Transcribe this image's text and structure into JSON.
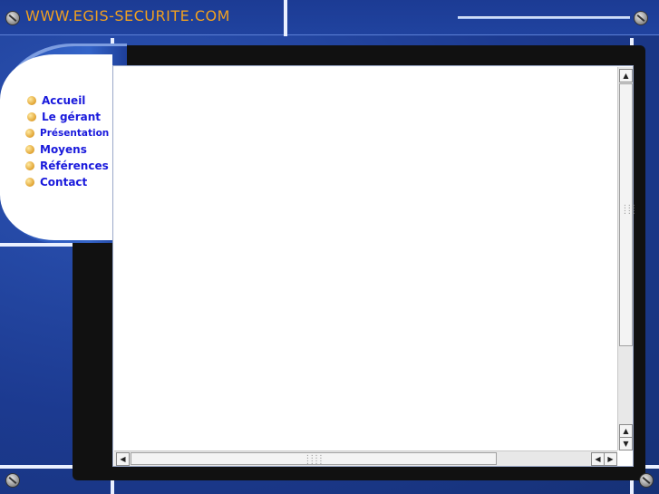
{
  "header": {
    "site_title": "WWW.EGIS-SECURITE.COM"
  },
  "nav": {
    "items": [
      {
        "label": "Accueil"
      },
      {
        "label": "Le gérant"
      },
      {
        "label": "Présentation"
      },
      {
        "label": "Moyens"
      },
      {
        "label": "Références"
      },
      {
        "label": "Contact"
      }
    ]
  },
  "icons": {
    "screw": "screw-icon",
    "arrow_up": "▲",
    "arrow_down": "▼",
    "arrow_left": "◀",
    "arrow_right": "▶"
  },
  "colors": {
    "background": "#1e3f9a",
    "title": "#f0a020",
    "nav_text": "#1a1adc",
    "bullet": "#e0a230"
  }
}
